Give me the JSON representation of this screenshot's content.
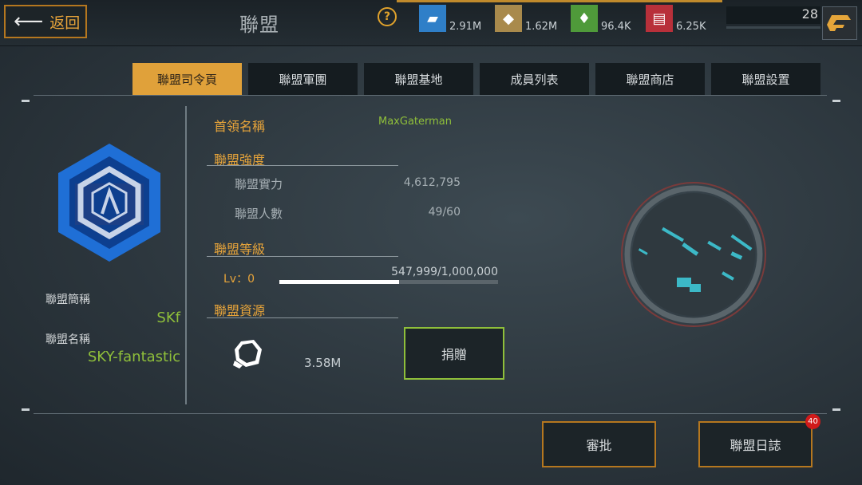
{
  "header": {
    "back_label": "返回",
    "title": "聯盟",
    "help_icon": "question-icon",
    "resources": [
      {
        "icon": "weapon-crate-icon",
        "color": "#2f7fc8",
        "value": "2.91M"
      },
      {
        "icon": "ore-icon",
        "color": "#a98a4c",
        "value": "1.62M"
      },
      {
        "icon": "crystal-icon",
        "color": "#4f9a3a",
        "value": "96.4K"
      },
      {
        "icon": "ammo-icon",
        "color": "#b8303a",
        "value": "6.25K"
      }
    ],
    "player_level": "28"
  },
  "tabs": [
    {
      "label": "聯盟司令頁",
      "active": true
    },
    {
      "label": "聯盟軍團",
      "active": false
    },
    {
      "label": "聯盟基地",
      "active": false
    },
    {
      "label": "成員列表",
      "active": false
    },
    {
      "label": "聯盟商店",
      "active": false
    },
    {
      "label": "聯盟設置",
      "active": false
    }
  ],
  "alliance": {
    "short_name_label": "聯盟簡稱",
    "short_name": "SKf",
    "name_label": "聯盟名稱",
    "name": "SKY-fantastic"
  },
  "info": {
    "leader_label": "首領名稱",
    "leader": "MaxGaterman",
    "strength_header": "聯盟強度",
    "power_label": "聯盟實力",
    "power": "4,612,795",
    "members_label": "聯盟人數",
    "members": "49/60",
    "level_header": "聯盟等級",
    "level_label": "Lv：0",
    "level_progress_text": "547,999/1,000,000",
    "level_progress": 0.548,
    "resources_header": "聯盟資源",
    "resource_amount": "3.58M",
    "donate_label": "捐贈"
  },
  "bottom": {
    "approve_label": "審批",
    "log_label": "聯盟日誌",
    "log_badge": "40"
  },
  "colors": {
    "accent": "#e0a13a",
    "green": "#8fbf3a",
    "alert": "#d01a1a"
  }
}
